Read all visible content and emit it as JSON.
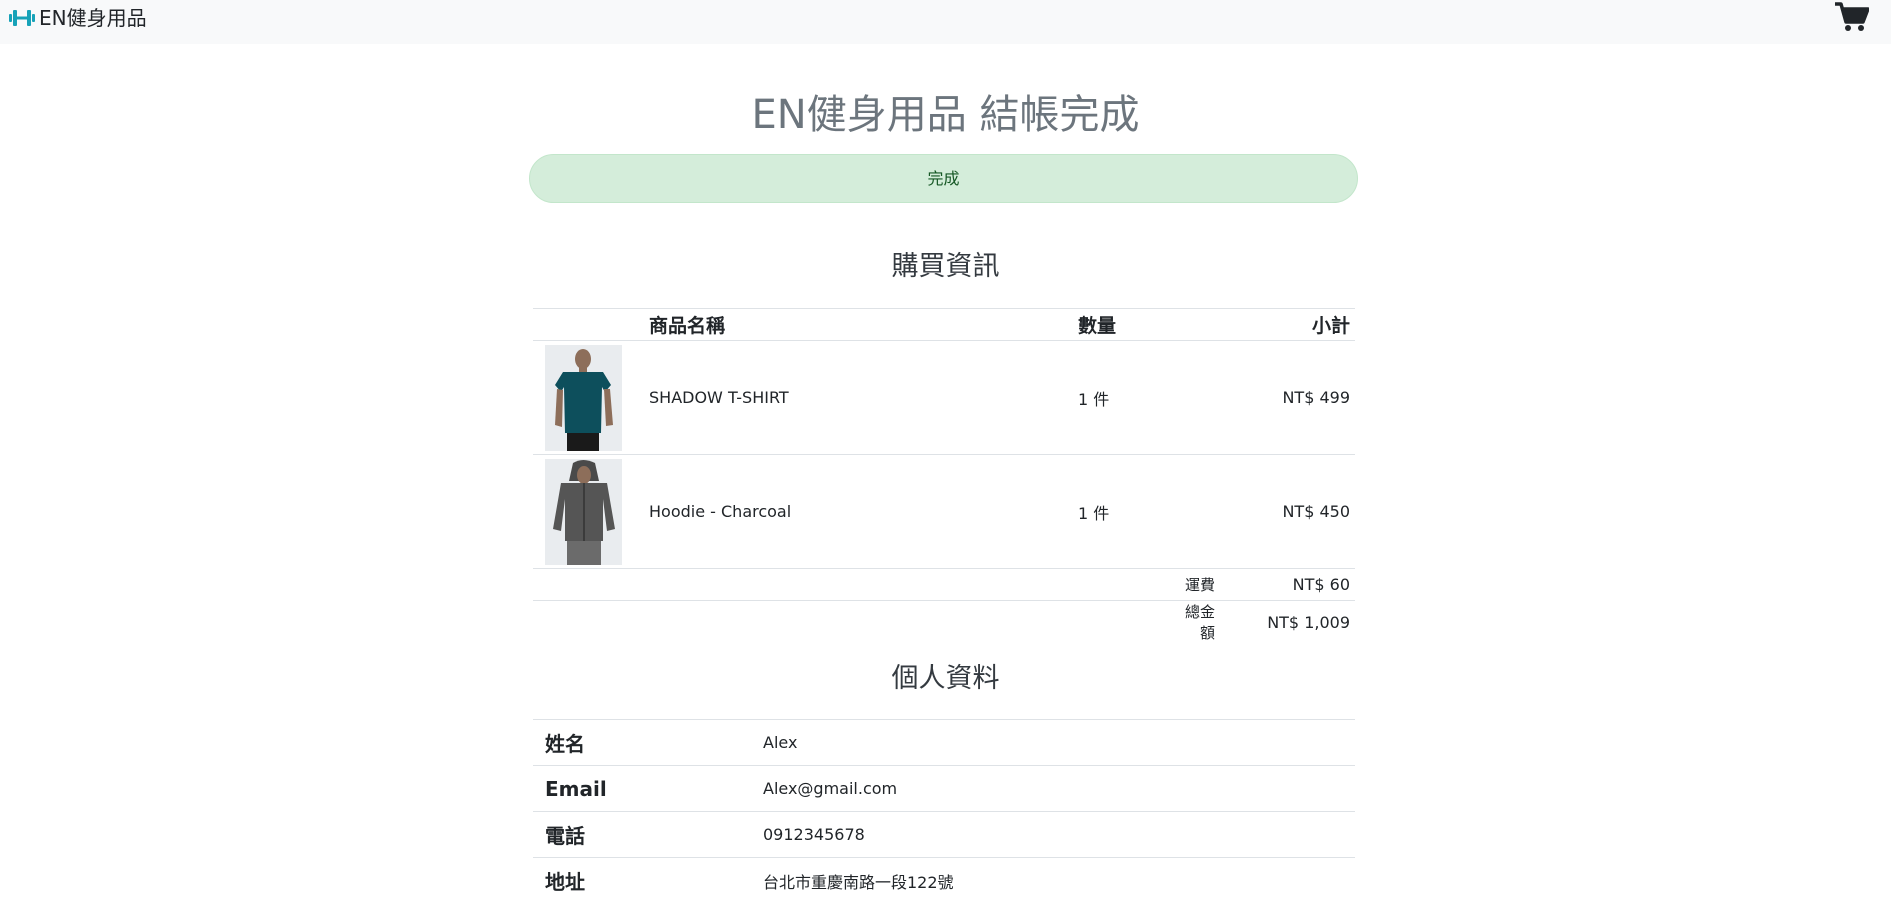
{
  "navbar": {
    "brand": "EN健身用品",
    "brand_icon": "dumbbell-icon",
    "cart_icon": "shopping-cart-icon"
  },
  "page_title": "EN健身用品 結帳完成",
  "alert_text": "完成",
  "purchase": {
    "title": "購買資訊",
    "columns": {
      "name": "商品名稱",
      "qty": "數量",
      "subtotal": "小計"
    },
    "items": [
      {
        "name": "SHADOW T-SHIRT",
        "qty": "1 件",
        "subtotal": "NT$ 499",
        "image": "teal-tshirt-photo"
      },
      {
        "name": "Hoodie - Charcoal",
        "qty": "1 件",
        "subtotal": "NT$ 450",
        "image": "charcoal-hoodie-photo"
      }
    ],
    "shipping": {
      "label": "運費",
      "value": "NT$ 60"
    },
    "total": {
      "label": "總金額",
      "value": "NT$ 1,009"
    }
  },
  "personal": {
    "title": "個人資料",
    "rows": [
      {
        "label": "姓名",
        "value": "Alex"
      },
      {
        "label": "Email",
        "value": "Alex@gmail.com"
      },
      {
        "label": "電話",
        "value": "0912345678"
      },
      {
        "label": "地址",
        "value": "台北市重慶南路一段122號"
      }
    ]
  },
  "colors": {
    "brand_icon": "#17a2b8",
    "alert_bg": "#d4edda",
    "alert_text": "#155724",
    "title_gray": "#6c757d",
    "navbar_bg": "#f8f9fa"
  }
}
